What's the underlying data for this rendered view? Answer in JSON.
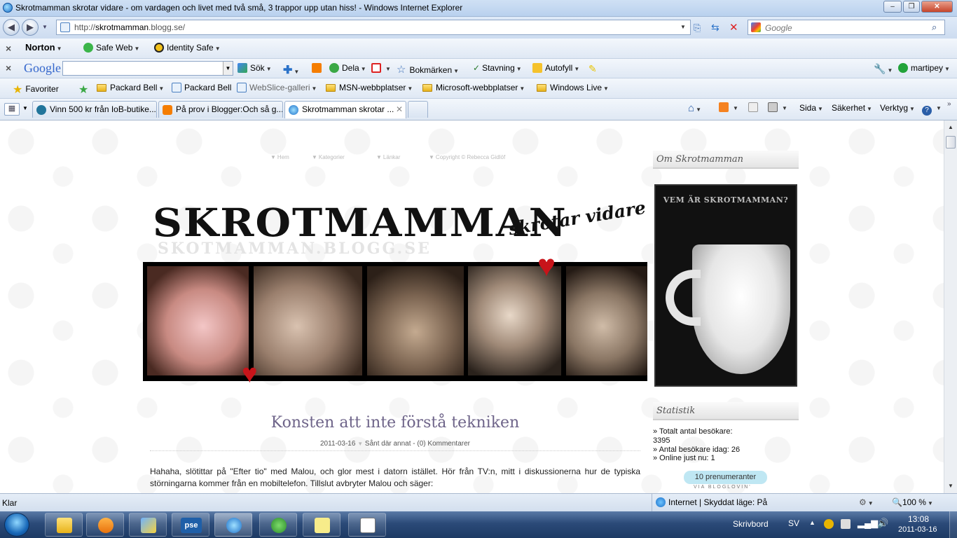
{
  "window": {
    "title": "Skrotmamman skrotar vidare - om vardagen och livet med två små, 3 trappor upp utan hiss! - Windows Internet Explorer",
    "minimize": "–",
    "restore": "❐",
    "close": "✕"
  },
  "address_bar": {
    "url_prefix": "http://",
    "url_host": "skrotmamman",
    "url_suffix": ".blogg.se/",
    "search_placeholder": "Google"
  },
  "norton_toolbar": {
    "brand": "Norton",
    "safe_web": "Safe Web",
    "identity_safe": "Identity Safe"
  },
  "google_toolbar": {
    "brand": "Google",
    "search_value": "",
    "sok": "Sök",
    "dela": "Dela",
    "bokmarken": "Bokmärken",
    "stavning": "Stavning",
    "autofyll": "Autofyll",
    "user": "martipey"
  },
  "favorites_bar": {
    "favoriter": "Favoriter",
    "items": [
      "Packard Bell",
      "Packard Bell",
      "WebSlice-galleri",
      "MSN-webbplatser",
      "Microsoft-webbplatser",
      "Windows Live"
    ]
  },
  "tabs": [
    {
      "label": "Vinn 500 kr från IoB-butike..."
    },
    {
      "label": "På prov i Blogger:Och så g..."
    },
    {
      "label": "Skrotmamman skrotar ..."
    }
  ],
  "command_bar": {
    "sida": "Sida",
    "sakerhet": "Säkerhet",
    "verktyg": "Verktyg"
  },
  "blog": {
    "nav": [
      "Hem",
      "Kategorier",
      "Länkar",
      "Copyright © Rebecca Gidlöf"
    ],
    "logo": "SKROTMAMMAN",
    "logo_sub": "SKOTMAMMAN.BLOGG.SE",
    "tagline": "skrotar vidare",
    "post": {
      "title": "Konsten att inte förstå tekniken",
      "date": "2011-03-16",
      "category": "Sånt där annat",
      "comments": "(0) Kommentarer",
      "text": "Hahaha, slötittar på \"Efter tio\" med Malou, och glor mest i datorn istället. Hör från TV:n, mitt i diskussionerna hur de typiska störningarna kommer från en mobiltelefon. Tillslut avbryter Malou och säger:"
    },
    "sidebar": {
      "about_heading": "Om Skrotmamman",
      "mug_title": "VEM ÄR SKROTMAMMAN?",
      "stats_heading": "Statistik",
      "stats": {
        "total_label": "» Totalt antal besökare:",
        "total_value": "3395",
        "today": "» Antal besökare idag: 26",
        "online": "» Online just nu: 1"
      },
      "subscribers": "10 prenumeranter",
      "via": "VIA BLOGLOVIN'"
    }
  },
  "status_bar": {
    "status": "Klar",
    "zone": "Internet | Skyddat läge: På",
    "zoom": "100 %"
  },
  "taskbar": {
    "skrivbord": "Skrivbord",
    "lang": "SV",
    "time": "13:08",
    "date": "2011-03-16",
    "pse": "pse"
  }
}
